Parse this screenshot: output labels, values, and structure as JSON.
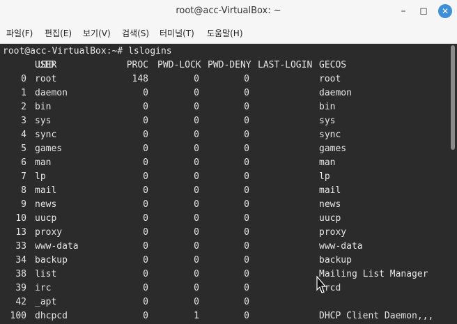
{
  "window": {
    "title": "root@acc-VirtualBox: ~"
  },
  "menu": [
    "파일(F)",
    "편집(E)",
    "보기(V)",
    "검색(S)",
    "터미널(T)",
    "도움말(H)"
  ],
  "terminal": {
    "prompt": "root@acc-VirtualBox:~# lslogins",
    "headers": [
      "UID",
      "USER",
      "PROC",
      "PWD-LOCK",
      "PWD-DENY",
      "LAST-LOGIN",
      "GECOS"
    ],
    "rows": [
      [
        "0",
        "root",
        "148",
        "0",
        "0",
        "",
        "root"
      ],
      [
        "1",
        "daemon",
        "0",
        "0",
        "0",
        "",
        "daemon"
      ],
      [
        "2",
        "bin",
        "0",
        "0",
        "0",
        "",
        "bin"
      ],
      [
        "3",
        "sys",
        "0",
        "0",
        "0",
        "",
        "sys"
      ],
      [
        "4",
        "sync",
        "0",
        "0",
        "0",
        "",
        "sync"
      ],
      [
        "5",
        "games",
        "0",
        "0",
        "0",
        "",
        "games"
      ],
      [
        "6",
        "man",
        "0",
        "0",
        "0",
        "",
        "man"
      ],
      [
        "7",
        "lp",
        "0",
        "0",
        "0",
        "",
        "lp"
      ],
      [
        "8",
        "mail",
        "0",
        "0",
        "0",
        "",
        "mail"
      ],
      [
        "9",
        "news",
        "0",
        "0",
        "0",
        "",
        "news"
      ],
      [
        "10",
        "uucp",
        "0",
        "0",
        "0",
        "",
        "uucp"
      ],
      [
        "13",
        "proxy",
        "0",
        "0",
        "0",
        "",
        "proxy"
      ],
      [
        "33",
        "www-data",
        "0",
        "0",
        "0",
        "",
        "www-data"
      ],
      [
        "34",
        "backup",
        "0",
        "0",
        "0",
        "",
        "backup"
      ],
      [
        "38",
        "list",
        "0",
        "0",
        "0",
        "",
        "Mailing List Manager"
      ],
      [
        "39",
        "irc",
        "0",
        "0",
        "0",
        "",
        "ircd"
      ],
      [
        "42",
        "_apt",
        "0",
        "0",
        "0",
        "",
        ""
      ],
      [
        "100",
        "dhcpcd",
        "0",
        "1",
        "0",
        "",
        "DHCP Client Daemon,,,"
      ]
    ]
  }
}
